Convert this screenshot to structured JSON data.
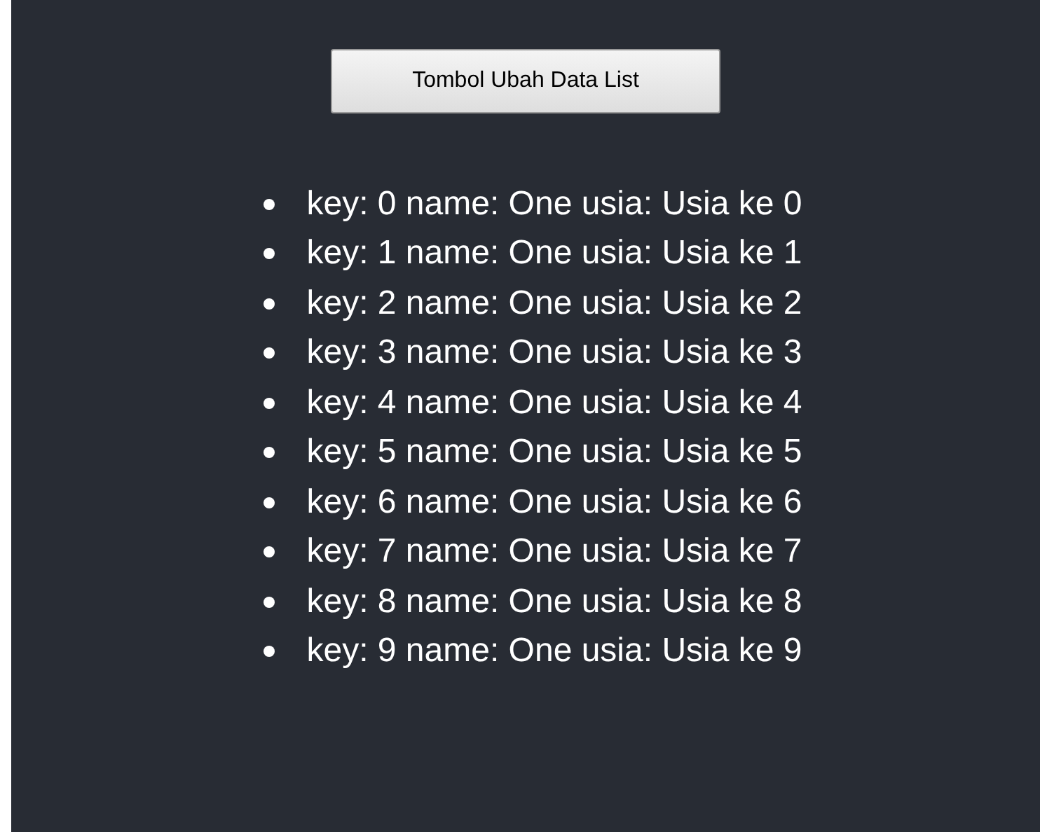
{
  "button": {
    "label": "Tombol Ubah Data List"
  },
  "items": [
    "key: 0 name: One usia: Usia ke 0",
    "key: 1 name: One usia: Usia ke 1",
    "key: 2 name: One usia: Usia ke 2",
    "key: 3 name: One usia: Usia ke 3",
    "key: 4 name: One usia: Usia ke 4",
    "key: 5 name: One usia: Usia ke 5",
    "key: 6 name: One usia: Usia ke 6",
    "key: 7 name: One usia: Usia ke 7",
    "key: 8 name: One usia: Usia ke 8",
    "key: 9 name: One usia: Usia ke 9"
  ]
}
